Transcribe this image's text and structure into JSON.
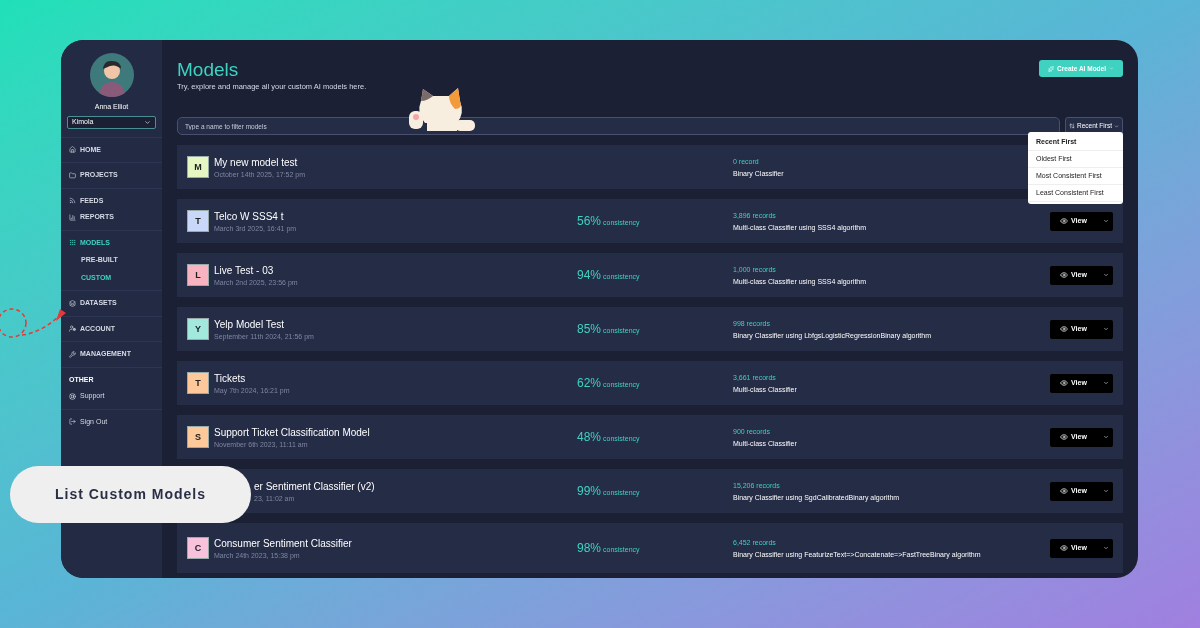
{
  "caption": "List Custom Models",
  "sidebar": {
    "user_name": "Anna Elliot",
    "workspace": "Kimola",
    "groups": [
      {
        "items": [
          {
            "label": "HOME",
            "selected": false
          }
        ]
      },
      {
        "items": [
          {
            "label": "PROJECTS",
            "selected": false
          }
        ]
      },
      {
        "items": [
          {
            "label": "FEEDS",
            "selected": false
          },
          {
            "label": "REPORTS",
            "selected": false
          }
        ]
      },
      {
        "items": [
          {
            "label": "MODELS",
            "selected": true,
            "children": [
              {
                "label": "PRE-BUILT",
                "selected": false
              },
              {
                "label": "CUSTOM",
                "selected": true
              }
            ]
          }
        ]
      },
      {
        "items": [
          {
            "label": "DATASETS",
            "selected": false
          }
        ]
      },
      {
        "items": [
          {
            "label": "ACCOUNT",
            "selected": false
          }
        ]
      },
      {
        "items": [
          {
            "label": "MANAGEMENT",
            "selected": false
          }
        ]
      },
      {
        "heading": "OTHER",
        "items": [
          {
            "label": "Support",
            "selected": false
          }
        ]
      },
      {
        "items": [
          {
            "label": "Sign Out",
            "selected": false
          }
        ]
      }
    ]
  },
  "header": {
    "title": "Models",
    "subtitle": "Try, explore and manage all your custom AI models here.",
    "create_button": "Create AI Model"
  },
  "search": {
    "placeholder": "Type a name to filter models"
  },
  "sort": {
    "label": "Recent First",
    "expanded": true,
    "options": [
      {
        "label": "Recent First",
        "selected": true
      },
      {
        "label": "Oldest First",
        "selected": false
      },
      {
        "label": "Most Consistent First",
        "selected": false
      },
      {
        "label": "Least Consistent First",
        "selected": false
      }
    ]
  },
  "models": [
    {
      "letter": "M",
      "color": "#e6f7c2",
      "name": "My new model test",
      "date": "October 14th 2025, 17:52 pm",
      "records": "0 record",
      "type": "Binary Classifier"
    },
    {
      "letter": "T",
      "color": "#c9d8f8",
      "name": "Telco W SSS4 t",
      "date": "March 3rd 2025, 16:41 pm",
      "consistency": "56%",
      "consistency_label": "consistency",
      "records": "3,896 records",
      "type": "Multi-class Classifier using SSS4 algorithm",
      "button": "View"
    },
    {
      "letter": "L",
      "color": "#f8b3c0",
      "name": "Live Test - 03",
      "date": "March 2nd 2025, 23:56 pm",
      "consistency": "94%",
      "consistency_label": "consistency",
      "records": "1,000 records",
      "type": "Multi-class Classifier using SSS4 algorithm",
      "button": "View"
    },
    {
      "letter": "Y",
      "color": "#a3e8dc",
      "name": "Yelp Model Test",
      "date": "September 11th 2024, 21:56 pm",
      "consistency": "85%",
      "consistency_label": "consistency",
      "records": "998 records",
      "type": "Binary Classifier using LbfgsLogisticRegressionBinary algorithm",
      "button": "View"
    },
    {
      "letter": "T",
      "color": "#fdc99a",
      "name": "Tickets",
      "date": "May 7th 2024, 16:21 pm",
      "consistency": "62%",
      "consistency_label": "consistency",
      "records": "3,661 records",
      "type": "Multi-class Classifier",
      "button": "View"
    },
    {
      "letter": "S",
      "color": "#fdc99a",
      "name": "Support Ticket Classification Model",
      "date": "November 6th 2023, 11:11 am",
      "consistency": "48%",
      "consistency_label": "consistency",
      "records": "900 records",
      "type": "Multi-class Classifier",
      "button": "View"
    },
    {
      "name": "er Sentiment Classifier (v2)",
      "date": "23, 11:02 am",
      "consistency": "99%",
      "consistency_label": "consistency",
      "records": "15,206 records",
      "type": "Binary Classifier using SgdCalibratedBinary algorithm",
      "button": "View"
    },
    {
      "letter": "C",
      "color": "#f9c2dc",
      "name": "Consumer Sentiment Classifier",
      "date": "March 24th 2023, 15:38 pm",
      "consistency": "98%",
      "consistency_label": "consistency",
      "records": "6,452 records",
      "type": "Binary Classifier using FeaturizeText=>Concatenate=>FastTreeBinary algorithm",
      "button": "View"
    }
  ]
}
